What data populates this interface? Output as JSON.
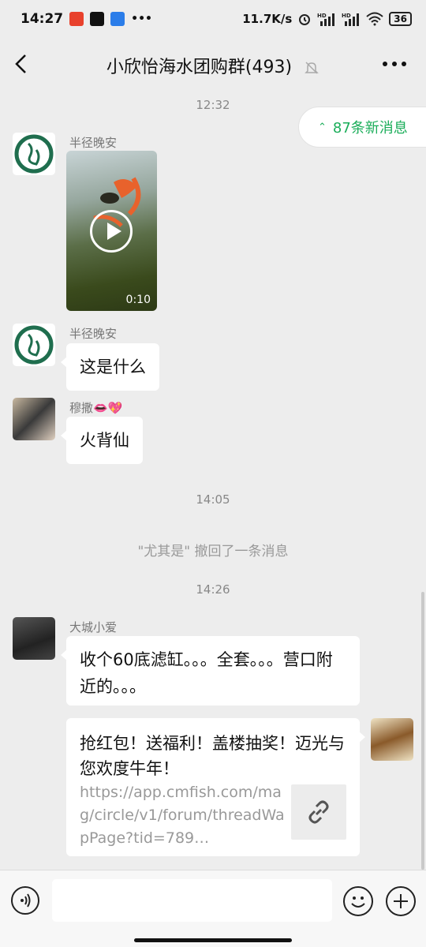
{
  "status_bar": {
    "time": "14:27",
    "net_speed": "11.7K/s",
    "battery": "36",
    "overflow": "•••",
    "app_badge_colors": [
      "#e8412c",
      "#111111",
      "#2b7de9"
    ],
    "hd_label": "HD"
  },
  "header": {
    "title": "小欣怡海水团购群(493)",
    "back_icon": "chevron-left-icon",
    "mute_icon": "bell-muted-icon",
    "more_icon": "more-dots-icon"
  },
  "new_messages": {
    "label": "87条新消息",
    "color": "#1aad59"
  },
  "messages": [
    {
      "type": "time",
      "text": "12:32"
    },
    {
      "type": "video",
      "sender": "半径晚安",
      "duration": "0:10"
    },
    {
      "type": "text",
      "sender": "半径晚安",
      "text": "这是什么"
    },
    {
      "type": "text",
      "sender": "穆撒👄💖",
      "text": "火背仙"
    },
    {
      "type": "time",
      "text": "14:05"
    },
    {
      "type": "system",
      "text": "\"尤其是\" 撤回了一条消息"
    },
    {
      "type": "time",
      "text": "14:26"
    },
    {
      "type": "text",
      "sender": "大城小爱",
      "text": "收个60底滤缸。。。全套。。。营口附近的。。。"
    },
    {
      "type": "link",
      "title": "抢红包！送福利！盖楼抽奖！迈光与您欢度牛年！",
      "url": "https://app.cmfish.com/mag/circle/v1/forum/threadWapPage?tid=789…",
      "thumb_icon": "link-icon"
    }
  ],
  "input_bar": {
    "placeholder": "",
    "voice_icon": "voice-icon",
    "emoji_icon": "emoji-icon",
    "plus_icon": "plus-icon"
  }
}
